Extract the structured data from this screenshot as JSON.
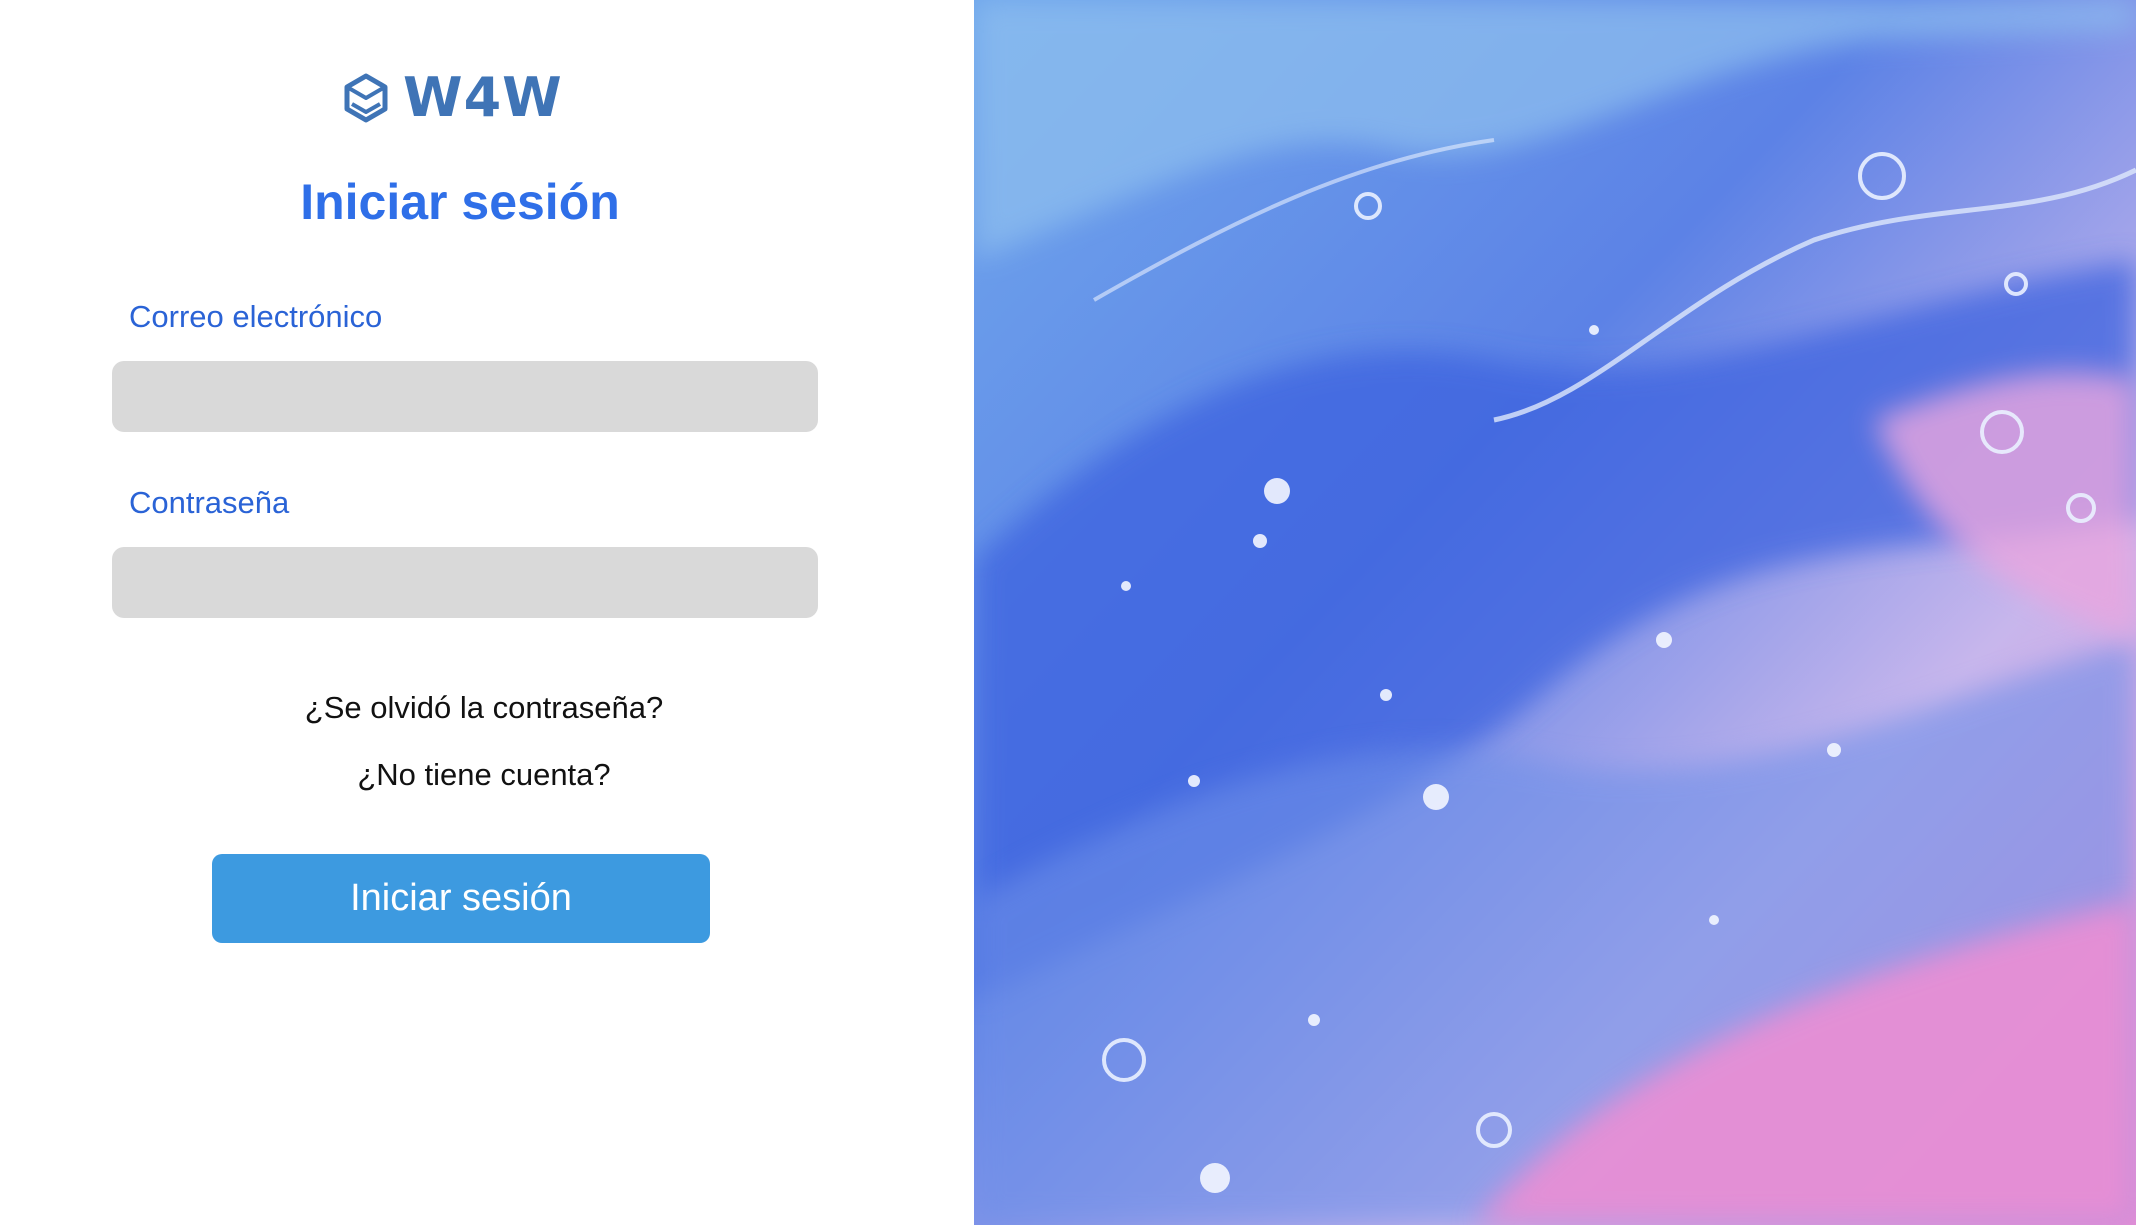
{
  "brand": {
    "name": "W4W",
    "logo_icon": "cube-hexagon-icon"
  },
  "form": {
    "title": "Iniciar sesión",
    "email_label": "Correo electrónico",
    "email_value": "",
    "password_label": "Contraseña",
    "password_value": "",
    "forgot_link": "¿Se olvidó la contraseña?",
    "signup_link": "¿No tiene cuenta?",
    "submit_label": "Iniciar sesión"
  },
  "hero": {
    "image": "abstract-fluid-paint-art"
  },
  "colors": {
    "accent": "#2f6fe8",
    "button": "#3d9ae0",
    "input_bg": "#d9d9d9",
    "logo": "#3f74b6"
  }
}
